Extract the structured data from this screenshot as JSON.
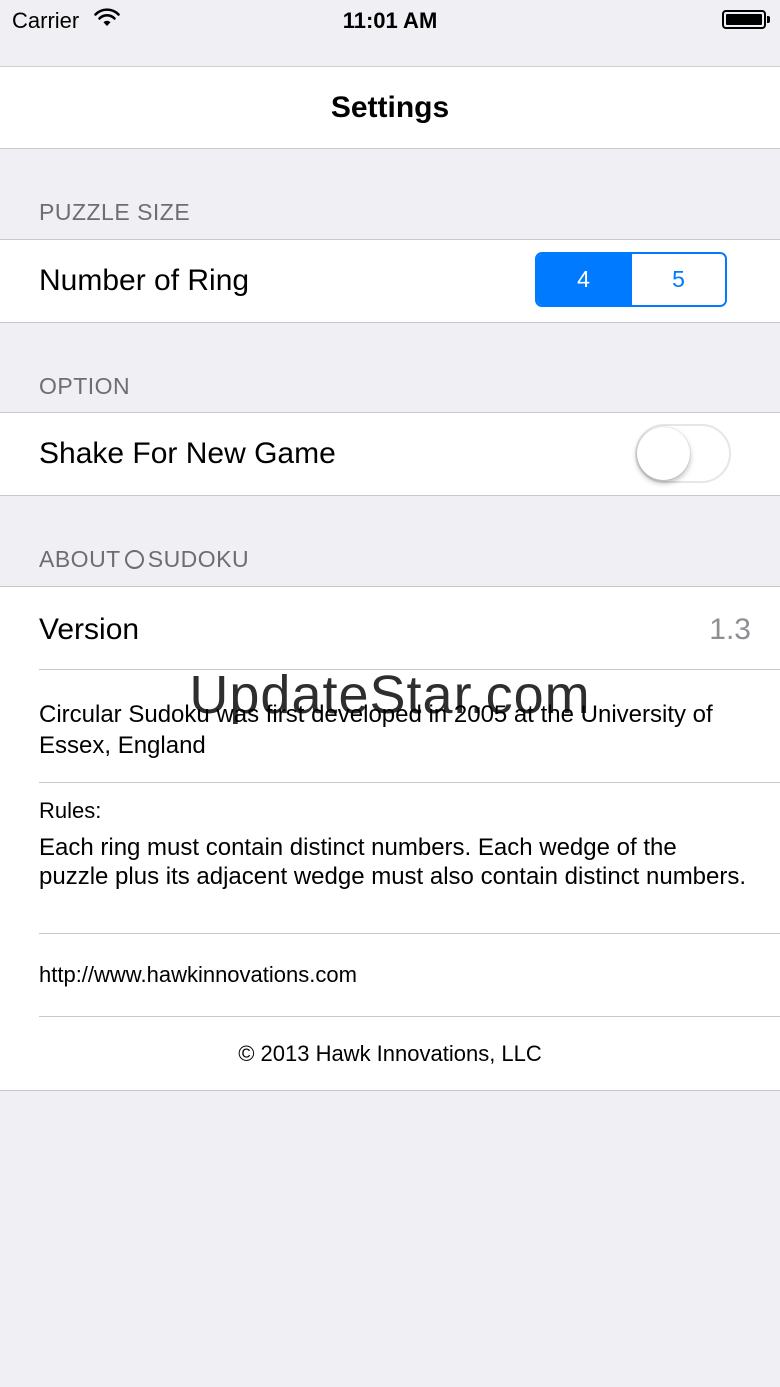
{
  "status_bar": {
    "carrier": "Carrier",
    "time": "11:01 AM"
  },
  "nav": {
    "title": "Settings"
  },
  "sections": {
    "puzzle_size": {
      "header": "PUZZLE SIZE",
      "ring_label": "Number of Ring",
      "segments": [
        "4",
        "5"
      ],
      "selected_segment": "4"
    },
    "option": {
      "header": "OPTION",
      "shake_label": "Shake For New Game",
      "shake_enabled": false
    },
    "about": {
      "header_before": "ABOUT",
      "header_after": "SUDOKU",
      "version_label": "Version",
      "version_value": "1.3",
      "history": "Circular Sudoku was first developed in 2005 at the University of Essex, England",
      "rules_heading": "Rules:",
      "rules_text": "Each ring must contain distinct numbers. Each wedge of the puzzle plus its adjacent wedge must also contain distinct numbers.",
      "url": "http://www.hawkinnovations.com",
      "copyright": "© 2013 Hawk Innovations, LLC"
    }
  },
  "watermark": "UpdateStar.com",
  "colors": {
    "accent": "#007aff",
    "background": "#efeff4",
    "section_header": "#6d6d72",
    "detail": "#8e8e93"
  },
  "icons": [
    "wifi-icon",
    "battery-icon",
    "ring-icon"
  ]
}
